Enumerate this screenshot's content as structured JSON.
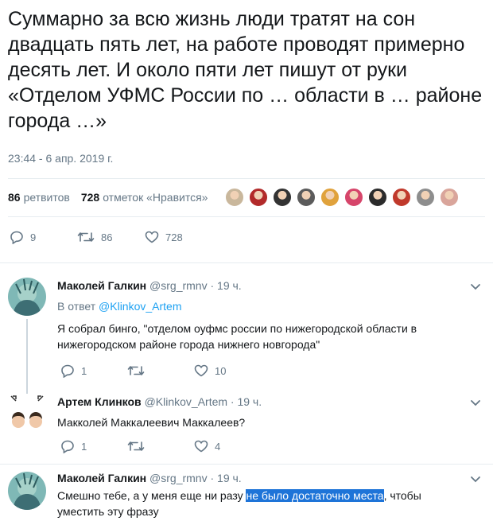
{
  "tweet": {
    "text": "Суммарно за всю жизнь люди тратят на сон двадцать пять лет, на работе проводят примерно десять лет. И около пяти лет пишут от руки «Отделом УФМС России по … области в … районе города …»",
    "timestamp": "23:44 - 6 апр. 2019 г.",
    "retweets_count": "86",
    "retweets_label": "ретвитов",
    "likes_count": "728",
    "likes_label": "отметок «Нравится»",
    "likers": [
      {
        "icon": "avatar-1",
        "color": "#c9b79c"
      },
      {
        "icon": "avatar-2",
        "color": "#b22a2a"
      },
      {
        "icon": "avatar-3",
        "color": "#333333"
      },
      {
        "icon": "avatar-4",
        "color": "#5b5b5b"
      },
      {
        "icon": "avatar-5",
        "color": "#e0a23c"
      },
      {
        "icon": "avatar-6",
        "color": "#d6456a"
      },
      {
        "icon": "avatar-7",
        "color": "#2b2b2b"
      },
      {
        "icon": "avatar-8",
        "color": "#c0392b"
      },
      {
        "icon": "avatar-9",
        "color": "#8d8d8d"
      },
      {
        "icon": "avatar-10",
        "color": "#d9a59b"
      }
    ],
    "actions": {
      "replies": "9",
      "retweets": "86",
      "likes": "728"
    }
  },
  "replies": [
    {
      "name": "Маколей Галкин",
      "handle": "@srg_rmnv · 19 ч.",
      "reply_to_label": "В ответ",
      "reply_to_user": "@Klinkov_Artem",
      "text": "Я собрал бинго, \"отделом оуфмс россии по нижегородской области в нижегородском районе города нижнего новгорода\"",
      "actions": {
        "replies": "1",
        "retweets": "",
        "likes": "10"
      }
    },
    {
      "name": "Артем Клинков",
      "handle": "@Klinkov_Artem · 19 ч.",
      "text": "Макколей Маккалеевич Маккалеев?",
      "actions": {
        "replies": "1",
        "retweets": "",
        "likes": "4"
      }
    },
    {
      "name": "Маколей Галкин",
      "handle": "@srg_rmnv · 19 ч.",
      "text_before": "Смешно тебе, а у меня еще ни разу ",
      "text_highlight": "не было достаточно места",
      "text_after": ", чтобы уместить эту фразу"
    }
  ],
  "colors": {
    "accent": "#1da1f2",
    "muted": "#657786",
    "text": "#14171a",
    "highlight": "#1e74d8"
  }
}
